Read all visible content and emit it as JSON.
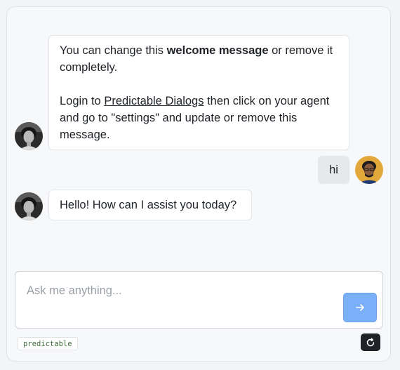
{
  "messages": [
    {
      "role": "bot",
      "para1_prefix": "You can change this ",
      "para1_bold": "welcome message",
      "para1_suffix": " or remove it completely.",
      "para2_prefix": "Login to ",
      "para2_link": "Predictable Dialogs",
      "para2_suffix": " then click on your agent and go to \"settings\" and update or remove this message."
    },
    {
      "role": "user",
      "text": "hi"
    },
    {
      "role": "bot",
      "text": "Hello! How can I assist you today?"
    }
  ],
  "input": {
    "placeholder": "Ask me anything...",
    "value": ""
  },
  "footer": {
    "brand_label": "predictable"
  },
  "icons": {
    "send": "arrow-right-icon",
    "refresh": "refresh-icon"
  },
  "colors": {
    "send_button": "#7ab0f7",
    "refresh_button": "#1f2328",
    "brand_text": "#3f6d3a"
  }
}
